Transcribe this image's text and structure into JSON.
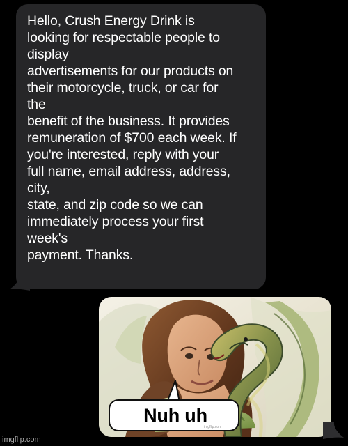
{
  "conversation": {
    "incoming_message": {
      "lines": [
        "Hello, Crush  Energy Drink is",
        "looking for respectable people to",
        "display",
        "advertisements for our products on",
        "their motorcycle, truck, or car for",
        "the",
        "benefit of the business. It provides",
        "remuneration of $700 each week. If",
        "you're interested, reply with your",
        "full name, email address, address,",
        "city,",
        "state, and zip code so we can",
        "immediately process your first",
        "week's",
        "payment. Thanks."
      ]
    },
    "outgoing_message": {
      "image_caption": "Nuh uh",
      "small_watermark": "imgflip.com"
    }
  },
  "footer": {
    "watermark": "imgflip.com"
  },
  "colors": {
    "background": "#000000",
    "incoming_bubble": "#262628",
    "outgoing_bubble": "#2e2e30",
    "message_text": "#ffffff"
  },
  "icons": {
    "incoming_tail": "incoming-message-tail-icon",
    "outgoing_tail": "outgoing-message-tail-icon",
    "speech_pointer": "speech-pointer-icon"
  }
}
